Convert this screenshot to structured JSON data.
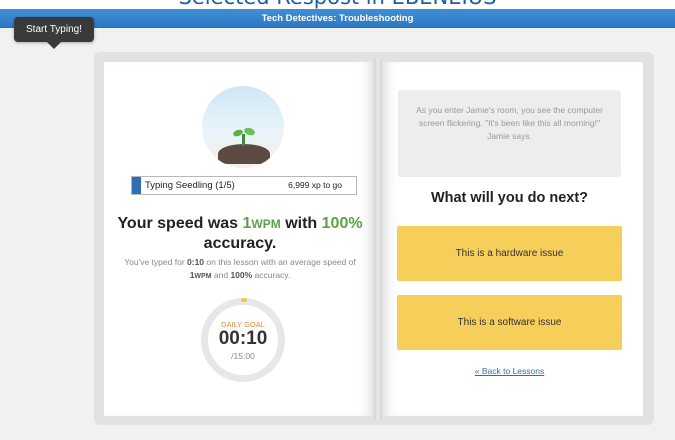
{
  "top_strip": {
    "cut_text": "Selected Respost in EBENEIUS"
  },
  "header": {
    "title": "Tech Detectives: Troubleshooting"
  },
  "tooltip": {
    "text": "Start Typing!"
  },
  "progress": {
    "label": "Typing Seedling (1/5)",
    "xp_to_go": "6,999 xp to go",
    "fill_fraction": 0.04,
    "fill_color": "#2f6db5"
  },
  "result": {
    "prefix": "Your speed was ",
    "speed_value": "1",
    "speed_unit": "WPM",
    "middle": " with ",
    "accuracy": "100%",
    "suffix": " accuracy.",
    "sub_p1": "You've typed for ",
    "sub_time": "0:10",
    "sub_p2": " on this lesson with an average speed of ",
    "sub_speed": "1",
    "sub_speed_unit": "WPM",
    "sub_p3": " and ",
    "sub_accuracy": "100%",
    "sub_p4": " accuracy."
  },
  "daily_goal": {
    "label": "DAILY GOAL",
    "time": "00:10",
    "total": "/15:00",
    "progress_fraction": 0.011
  },
  "story": {
    "text": "As you enter Jamie's room, you see the computer screen flickering. \"It's been like this all morning!\" Jamie says."
  },
  "question": "What will you do next?",
  "choices": [
    {
      "label": "This is a hardware issue"
    },
    {
      "label": "This is a software issue"
    }
  ],
  "back_link": "« Back to Lessons",
  "colors": {
    "accent_green": "#5aa347",
    "choice_yellow": "#f6cf5a",
    "header_blue": "#3f8fd6",
    "link_blue": "#2f6db5"
  }
}
